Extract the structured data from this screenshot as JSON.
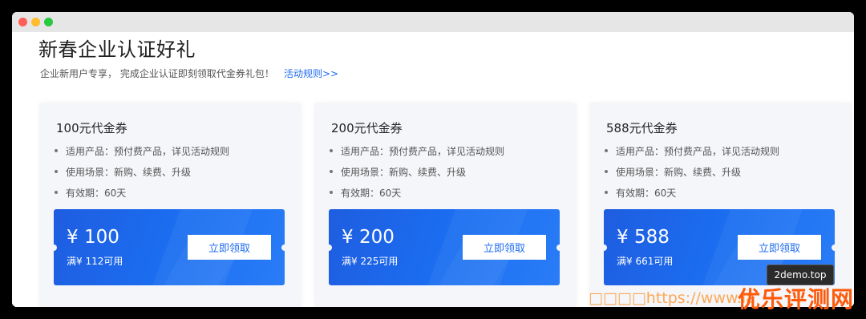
{
  "window": {
    "controls": [
      "close",
      "minimize",
      "maximize"
    ]
  },
  "page": {
    "title": "新春企业认证好礼",
    "subtitle": "企业新用户专享， 完成企业认证即刻领取代金券礼包！",
    "rules_link": "活动规则>>"
  },
  "cards": [
    {
      "title": "100元代金券",
      "features": [
        "适用产品：预付费产品，详见活动规则",
        "使用场景：新购、续费、升级",
        "有效期：60天"
      ],
      "amount": "¥ 100",
      "condition": "满¥ 112可用",
      "button": "立即领取"
    },
    {
      "title": "200元代金券",
      "features": [
        "适用产品：预付费产品，详见活动规则",
        "使用场景：新购、续费、升级",
        "有效期：60天"
      ],
      "amount": "¥ 200",
      "condition": "满¥ 225可用",
      "button": "立即领取"
    },
    {
      "title": "588元代金券",
      "features": [
        "适用产品：预付费产品，详见活动规则",
        "使用场景：新购、续费、升级",
        "有效期：60天"
      ],
      "amount": "¥ 588",
      "condition": "满¥ 661可用",
      "button": "立即领取"
    }
  ],
  "tooltip": "2demo.top",
  "watermark": {
    "url": "□□□□https://www.la",
    "logo": "优乐评测网"
  },
  "colors": {
    "accent": "#1e6cf0",
    "coupon": "#1f5de0",
    "card_bg": "#f4f6f9"
  }
}
